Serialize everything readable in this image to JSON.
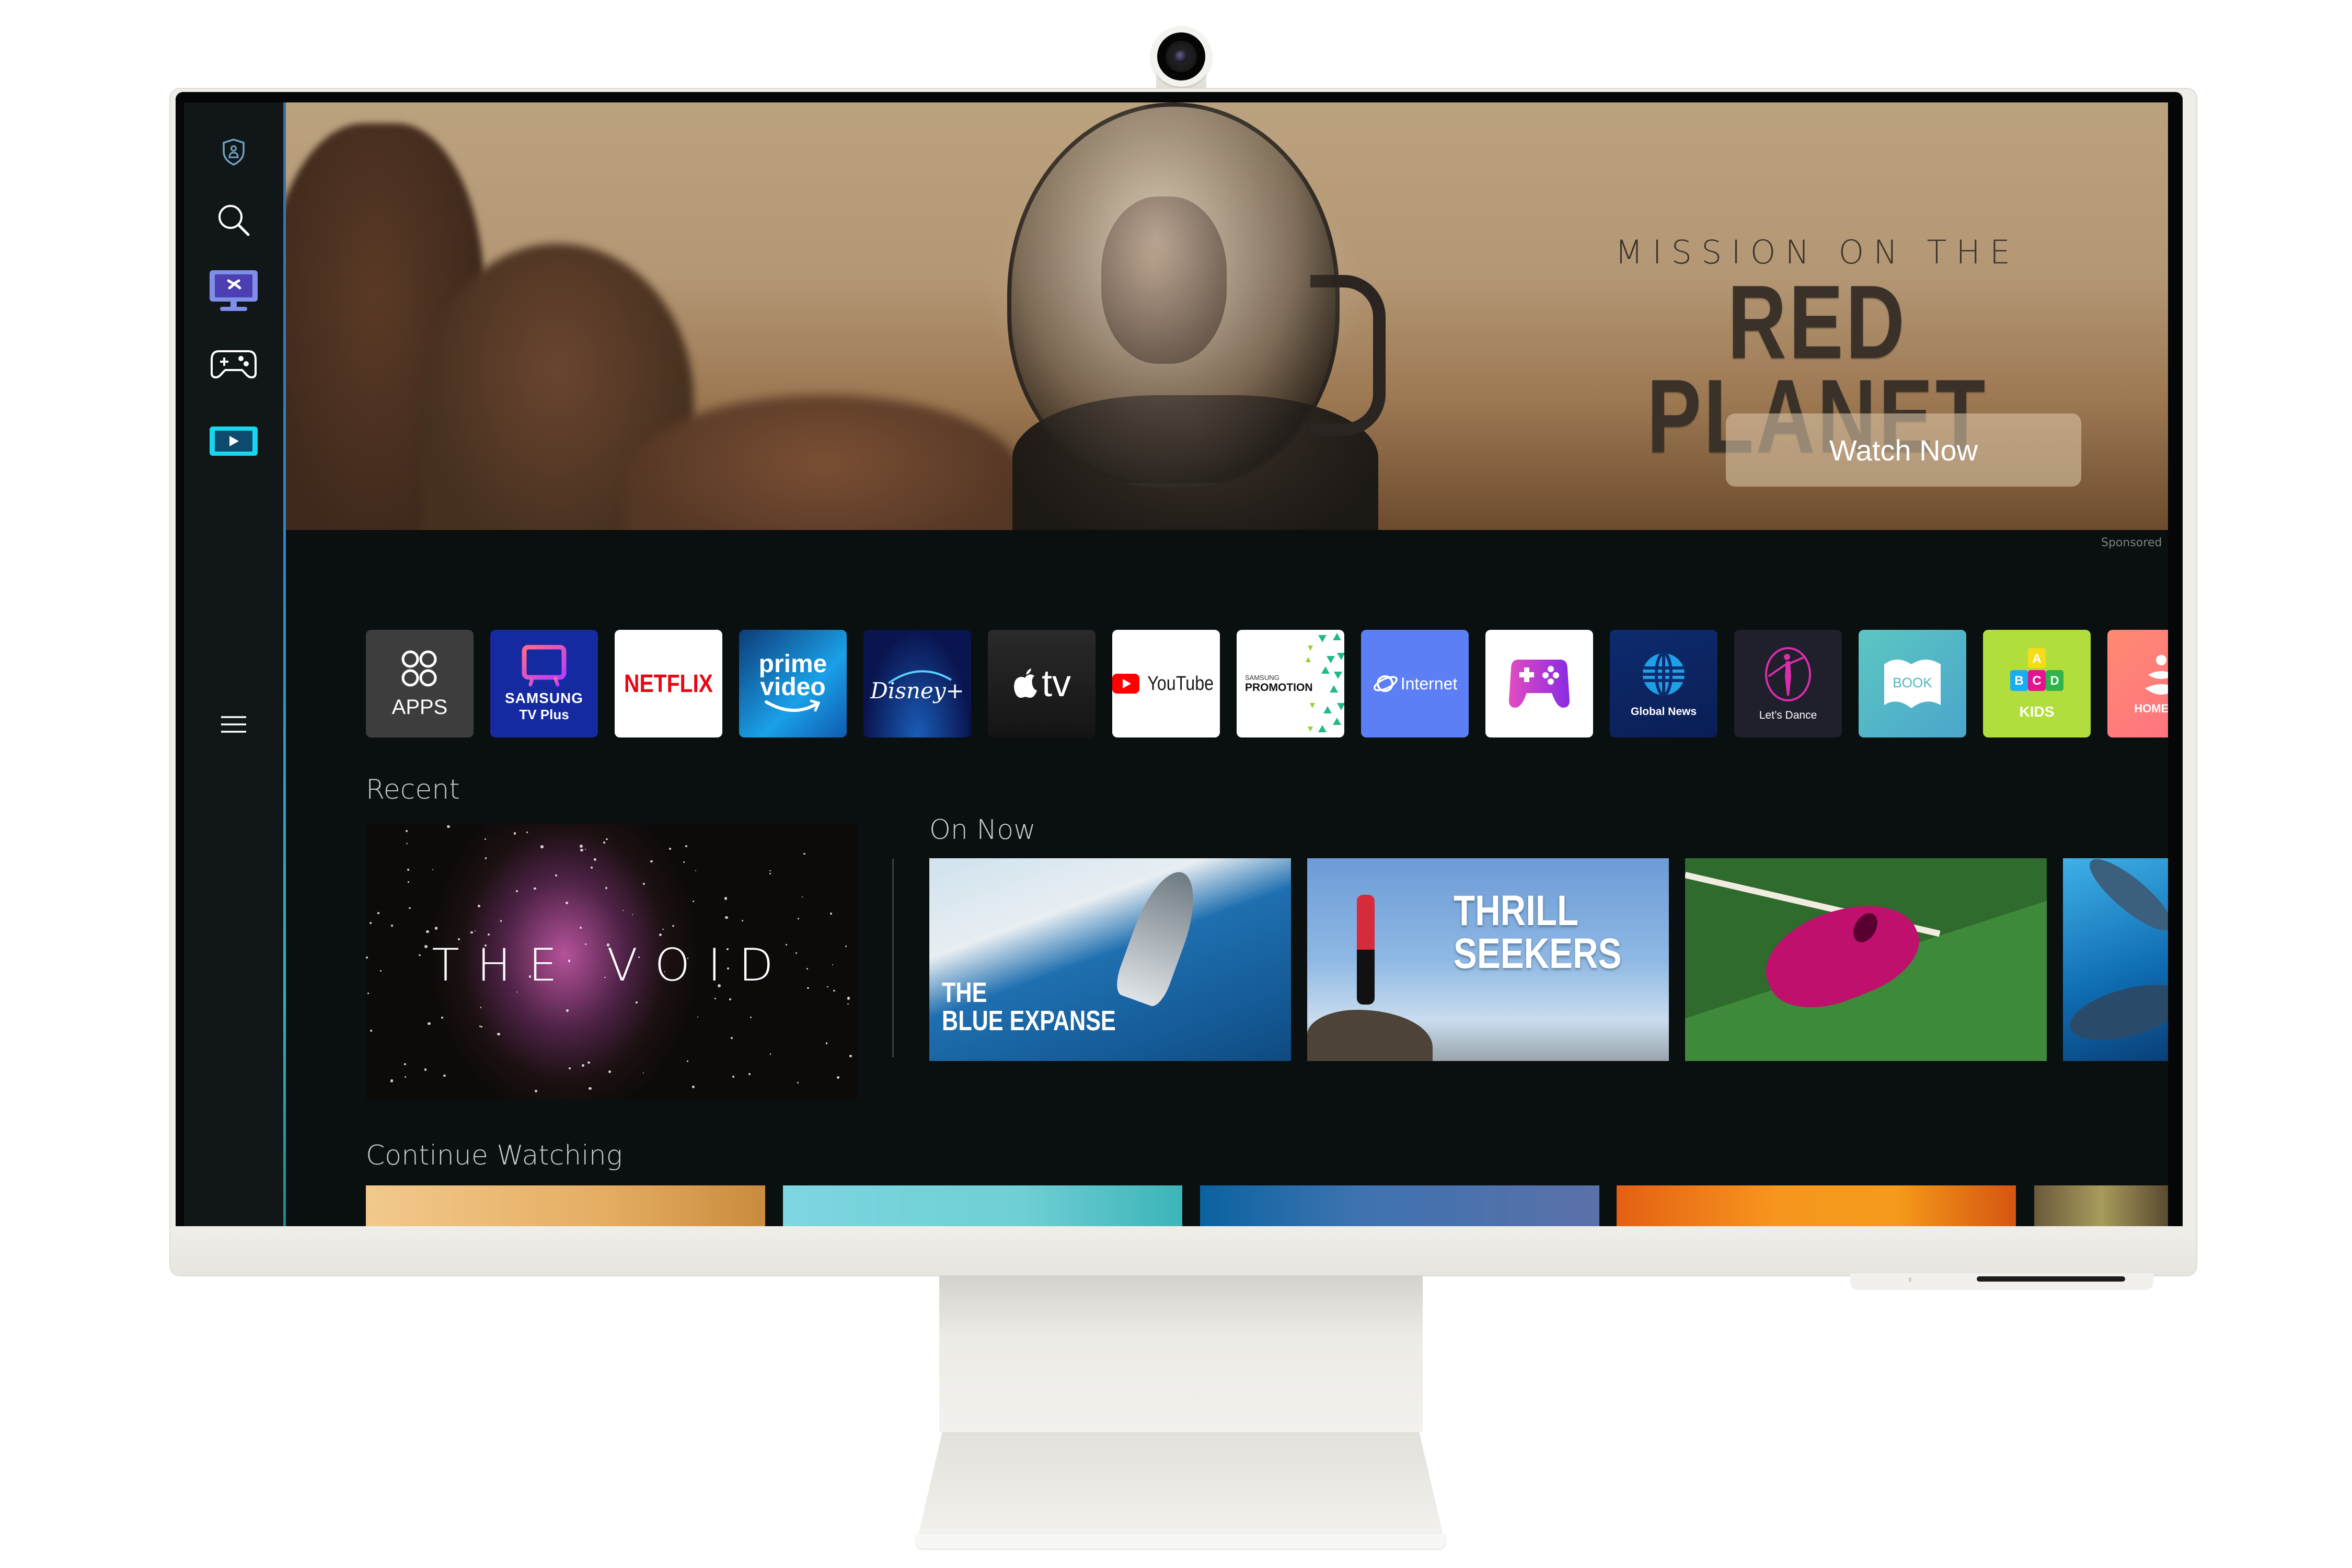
{
  "sidebar": {
    "items": [
      {
        "name": "privacy-shield",
        "icon": "shield-user-icon"
      },
      {
        "name": "search",
        "icon": "search-icon"
      },
      {
        "name": "media-source",
        "icon": "monitor-remote-icon"
      },
      {
        "name": "gaming-hub",
        "icon": "gamepad-icon"
      },
      {
        "name": "media",
        "icon": "play-screen-icon"
      },
      {
        "name": "menu",
        "icon": "hamburger-menu-icon"
      }
    ],
    "accent": "#2bb6c0"
  },
  "hero": {
    "subtitle": "MISSION ON THE",
    "title": "RED PLANET",
    "cta_label": "Watch Now",
    "sponsored_label": "Sponsored"
  },
  "apps": [
    {
      "id": "apps",
      "label": "APPS",
      "bg": "#3d3d3d"
    },
    {
      "id": "samsung-tv-plus",
      "label": "SAMSUNG",
      "sublabel": "TV Plus",
      "bg": "#1529a0"
    },
    {
      "id": "netflix",
      "label": "NETFLIX",
      "bg": "#ffffff",
      "fg": "#e50914"
    },
    {
      "id": "prime-video",
      "label": "prime",
      "sublabel": "video",
      "bg": "#1a98ff"
    },
    {
      "id": "disney-plus",
      "label": "Disney+",
      "bg": "#0b1e57"
    },
    {
      "id": "apple-tv",
      "label": "tv",
      "bg": "#1a1a1a"
    },
    {
      "id": "youtube",
      "label": "YouTube",
      "bg": "#ffffff"
    },
    {
      "id": "samsung-promotion",
      "label": "PROMOTION",
      "sublabel": "SAMSUNG",
      "bg": "#ffffff"
    },
    {
      "id": "internet",
      "label": "Internet",
      "bg": "#5c7ff5"
    },
    {
      "id": "game",
      "label": "",
      "bg": "#ffffff"
    },
    {
      "id": "global-news",
      "label": "Global News",
      "bg": "#0c2a6e"
    },
    {
      "id": "lets-dance",
      "label": "Let’s Dance",
      "bg": "#201f2c"
    },
    {
      "id": "book",
      "label": "BOOK",
      "bg": "#4fb4c8"
    },
    {
      "id": "kids",
      "label": "KIDS",
      "blocks": [
        "A",
        "B",
        "C",
        "D"
      ],
      "bg": "#b1de3d"
    },
    {
      "id": "home-yoga",
      "label": "HOME YO",
      "bg": "#ff7b7b"
    }
  ],
  "sections": {
    "recent": {
      "title": "Recent",
      "items": [
        {
          "title": "THE VOID"
        }
      ]
    },
    "on_now": {
      "title": "On Now",
      "items": [
        {
          "title_line1": "THE",
          "title_line2": "BLUE EXPANSE"
        },
        {
          "title_line1": "THRILL",
          "title_line2": "SEEKERS"
        },
        {
          "title_line1": "",
          "title_line2": ""
        },
        {
          "title_line1": "",
          "title_line2": ""
        }
      ]
    },
    "continue_watching": {
      "title": "Continue Watching"
    }
  }
}
